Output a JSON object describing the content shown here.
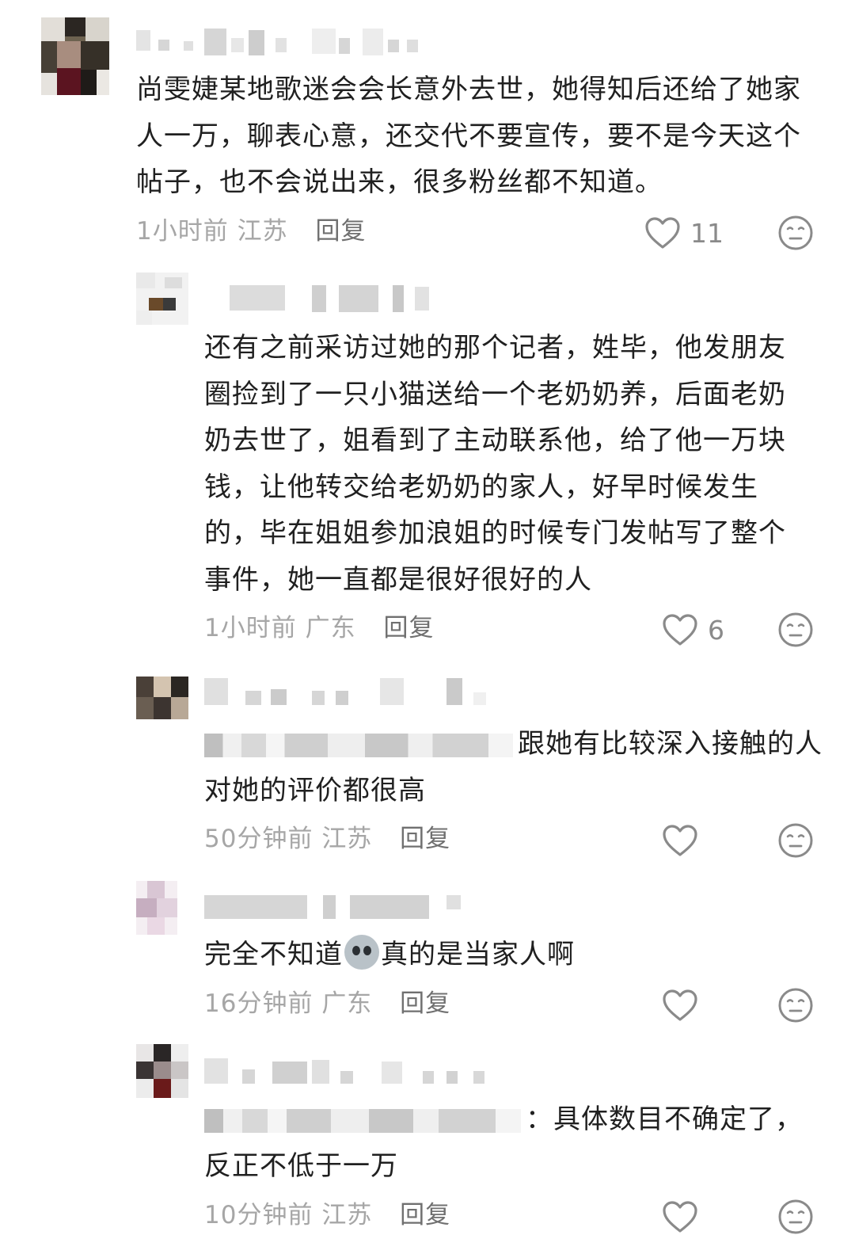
{
  "comments": [
    {
      "text": "尚雯婕某地歌迷会会长意外去世，她得知后还给了她家人一万，聊表心意，还交代不要宣传，要不是今天这个帖子，也不会说出来，很多粉丝都不知道。",
      "time": "1小时前",
      "location": "江苏",
      "reply_label": "回复",
      "likes": "11"
    },
    {
      "text": "还有之前采访过她的那个记者，姓毕，他发朋友圈捡到了一只小猫送给一个老奶奶养，后面老奶奶去世了，姐看到了主动联系他，给了他一万块钱，让他转交给老奶奶的家人，好早时候发生的，毕在姐姐参加浪姐的时候专门发帖写了整个事件，她一直都是很好很好的人",
      "time": "1小时前",
      "location": "广东",
      "reply_label": "回复",
      "likes": "6"
    },
    {
      "text": "跟她有比较深入接触的人对她的评价都很高",
      "time": "50分钟前",
      "location": "江苏",
      "reply_label": "回复",
      "likes": ""
    },
    {
      "text_before": "完全不知道",
      "text_after": "真的是当家人啊",
      "emoji_icon": "crying-face-icon",
      "time": "16分钟前",
      "location": "广东",
      "reply_label": "回复",
      "likes": ""
    },
    {
      "text": "：具体数目不确定了，反正不低于一万",
      "time": "10分钟前",
      "location": "江苏",
      "reply_label": "回复",
      "likes": ""
    }
  ],
  "icons": {
    "like": "heart-outline-icon",
    "dislike": "neutral-face-icon"
  },
  "colors": {
    "text": "#202020",
    "meta": "#a6a6a6",
    "reply": "#707070",
    "icon": "#8a8a8a"
  }
}
